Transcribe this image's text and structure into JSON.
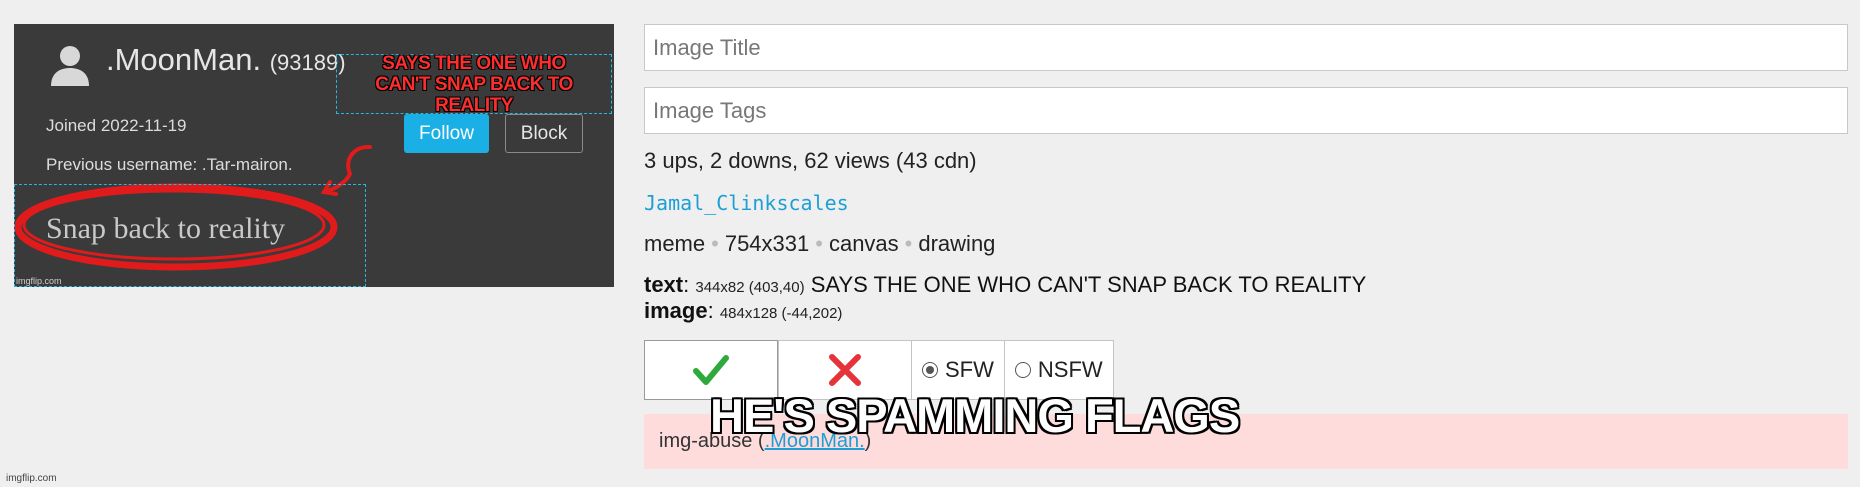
{
  "meme": {
    "username": ".MoonMan.",
    "score": "(93189)",
    "joined": "Joined 2022-11-19",
    "previous_username": "Previous username: .Tar-mairon.",
    "follow_label": "Follow",
    "block_label": "Block",
    "overlay_text_line1": "SAYS THE ONE WHO",
    "overlay_text_line2": "CAN'T SNAP BACK TO REALITY",
    "snap_text": "Snap back to reality",
    "watermark": "imgflip.com"
  },
  "form": {
    "title_placeholder": "Image Title",
    "tags_placeholder": "Image Tags"
  },
  "stats": "3 ups, 2 downs, 62 views (43 cdn)",
  "uploader": "Jamal_Clinkscales",
  "meta": {
    "type": "meme",
    "size": "754x331",
    "mode": "canvas",
    "tool": "drawing"
  },
  "layers": {
    "text_label": "text",
    "text_dims": "344x82 (403,40)",
    "text_value": "SAYS THE ONE WHO CAN'T SNAP BACK TO REALITY",
    "image_label": "image",
    "image_dims": "484x128 (-44,202)"
  },
  "moderation": {
    "sfw_label": "SFW",
    "nsfw_label": "NSFW",
    "selected": "SFW",
    "approve_color": "#2eaa3c",
    "reject_color": "#e5333a"
  },
  "abuse": {
    "prefix": "img-abuse (",
    "link": ".MoonMan.",
    "suffix": ")"
  },
  "caption": "HE'S SPAMMING FLAGS",
  "page_watermark": "imgflip.com"
}
